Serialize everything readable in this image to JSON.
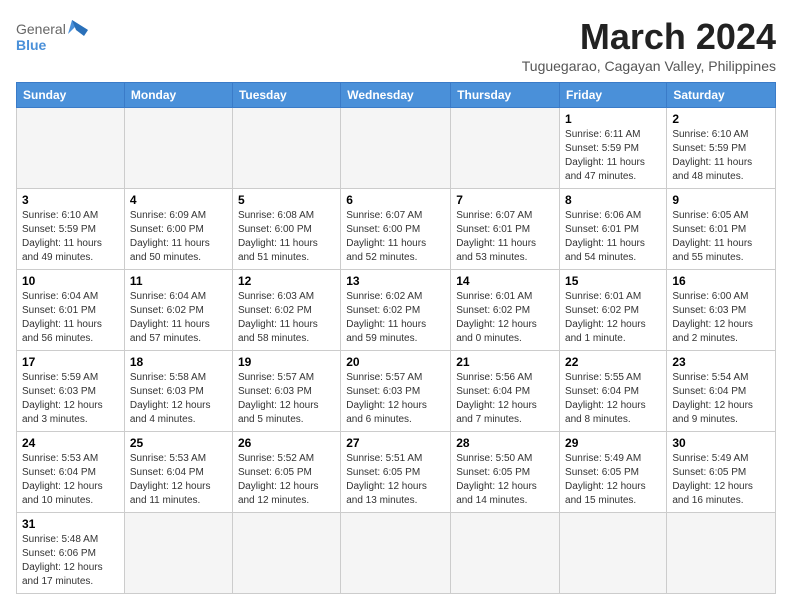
{
  "header": {
    "logo_general": "General",
    "logo_blue": "Blue",
    "month_title": "March 2024",
    "subtitle": "Tuguegarao, Cagayan Valley, Philippines"
  },
  "weekdays": [
    "Sunday",
    "Monday",
    "Tuesday",
    "Wednesday",
    "Thursday",
    "Friday",
    "Saturday"
  ],
  "weeks": [
    [
      {
        "day": "",
        "info": "",
        "empty": true
      },
      {
        "day": "",
        "info": "",
        "empty": true
      },
      {
        "day": "",
        "info": "",
        "empty": true
      },
      {
        "day": "",
        "info": "",
        "empty": true
      },
      {
        "day": "",
        "info": "",
        "empty": true
      },
      {
        "day": "1",
        "info": "Sunrise: 6:11 AM\nSunset: 5:59 PM\nDaylight: 11 hours and 47 minutes."
      },
      {
        "day": "2",
        "info": "Sunrise: 6:10 AM\nSunset: 5:59 PM\nDaylight: 11 hours and 48 minutes."
      }
    ],
    [
      {
        "day": "3",
        "info": "Sunrise: 6:10 AM\nSunset: 5:59 PM\nDaylight: 11 hours and 49 minutes."
      },
      {
        "day": "4",
        "info": "Sunrise: 6:09 AM\nSunset: 6:00 PM\nDaylight: 11 hours and 50 minutes."
      },
      {
        "day": "5",
        "info": "Sunrise: 6:08 AM\nSunset: 6:00 PM\nDaylight: 11 hours and 51 minutes."
      },
      {
        "day": "6",
        "info": "Sunrise: 6:07 AM\nSunset: 6:00 PM\nDaylight: 11 hours and 52 minutes."
      },
      {
        "day": "7",
        "info": "Sunrise: 6:07 AM\nSunset: 6:01 PM\nDaylight: 11 hours and 53 minutes."
      },
      {
        "day": "8",
        "info": "Sunrise: 6:06 AM\nSunset: 6:01 PM\nDaylight: 11 hours and 54 minutes."
      },
      {
        "day": "9",
        "info": "Sunrise: 6:05 AM\nSunset: 6:01 PM\nDaylight: 11 hours and 55 minutes."
      }
    ],
    [
      {
        "day": "10",
        "info": "Sunrise: 6:04 AM\nSunset: 6:01 PM\nDaylight: 11 hours and 56 minutes."
      },
      {
        "day": "11",
        "info": "Sunrise: 6:04 AM\nSunset: 6:02 PM\nDaylight: 11 hours and 57 minutes."
      },
      {
        "day": "12",
        "info": "Sunrise: 6:03 AM\nSunset: 6:02 PM\nDaylight: 11 hours and 58 minutes."
      },
      {
        "day": "13",
        "info": "Sunrise: 6:02 AM\nSunset: 6:02 PM\nDaylight: 11 hours and 59 minutes."
      },
      {
        "day": "14",
        "info": "Sunrise: 6:01 AM\nSunset: 6:02 PM\nDaylight: 12 hours and 0 minutes."
      },
      {
        "day": "15",
        "info": "Sunrise: 6:01 AM\nSunset: 6:02 PM\nDaylight: 12 hours and 1 minute."
      },
      {
        "day": "16",
        "info": "Sunrise: 6:00 AM\nSunset: 6:03 PM\nDaylight: 12 hours and 2 minutes."
      }
    ],
    [
      {
        "day": "17",
        "info": "Sunrise: 5:59 AM\nSunset: 6:03 PM\nDaylight: 12 hours and 3 minutes."
      },
      {
        "day": "18",
        "info": "Sunrise: 5:58 AM\nSunset: 6:03 PM\nDaylight: 12 hours and 4 minutes."
      },
      {
        "day": "19",
        "info": "Sunrise: 5:57 AM\nSunset: 6:03 PM\nDaylight: 12 hours and 5 minutes."
      },
      {
        "day": "20",
        "info": "Sunrise: 5:57 AM\nSunset: 6:03 PM\nDaylight: 12 hours and 6 minutes."
      },
      {
        "day": "21",
        "info": "Sunrise: 5:56 AM\nSunset: 6:04 PM\nDaylight: 12 hours and 7 minutes."
      },
      {
        "day": "22",
        "info": "Sunrise: 5:55 AM\nSunset: 6:04 PM\nDaylight: 12 hours and 8 minutes."
      },
      {
        "day": "23",
        "info": "Sunrise: 5:54 AM\nSunset: 6:04 PM\nDaylight: 12 hours and 9 minutes."
      }
    ],
    [
      {
        "day": "24",
        "info": "Sunrise: 5:53 AM\nSunset: 6:04 PM\nDaylight: 12 hours and 10 minutes."
      },
      {
        "day": "25",
        "info": "Sunrise: 5:53 AM\nSunset: 6:04 PM\nDaylight: 12 hours and 11 minutes."
      },
      {
        "day": "26",
        "info": "Sunrise: 5:52 AM\nSunset: 6:05 PM\nDaylight: 12 hours and 12 minutes."
      },
      {
        "day": "27",
        "info": "Sunrise: 5:51 AM\nSunset: 6:05 PM\nDaylight: 12 hours and 13 minutes."
      },
      {
        "day": "28",
        "info": "Sunrise: 5:50 AM\nSunset: 6:05 PM\nDaylight: 12 hours and 14 minutes."
      },
      {
        "day": "29",
        "info": "Sunrise: 5:49 AM\nSunset: 6:05 PM\nDaylight: 12 hours and 15 minutes."
      },
      {
        "day": "30",
        "info": "Sunrise: 5:49 AM\nSunset: 6:05 PM\nDaylight: 12 hours and 16 minutes."
      }
    ],
    [
      {
        "day": "31",
        "info": "Sunrise: 5:48 AM\nSunset: 6:06 PM\nDaylight: 12 hours and 17 minutes."
      },
      {
        "day": "",
        "info": "",
        "empty": true
      },
      {
        "day": "",
        "info": "",
        "empty": true
      },
      {
        "day": "",
        "info": "",
        "empty": true
      },
      {
        "day": "",
        "info": "",
        "empty": true
      },
      {
        "day": "",
        "info": "",
        "empty": true
      },
      {
        "day": "",
        "info": "",
        "empty": true
      }
    ]
  ]
}
